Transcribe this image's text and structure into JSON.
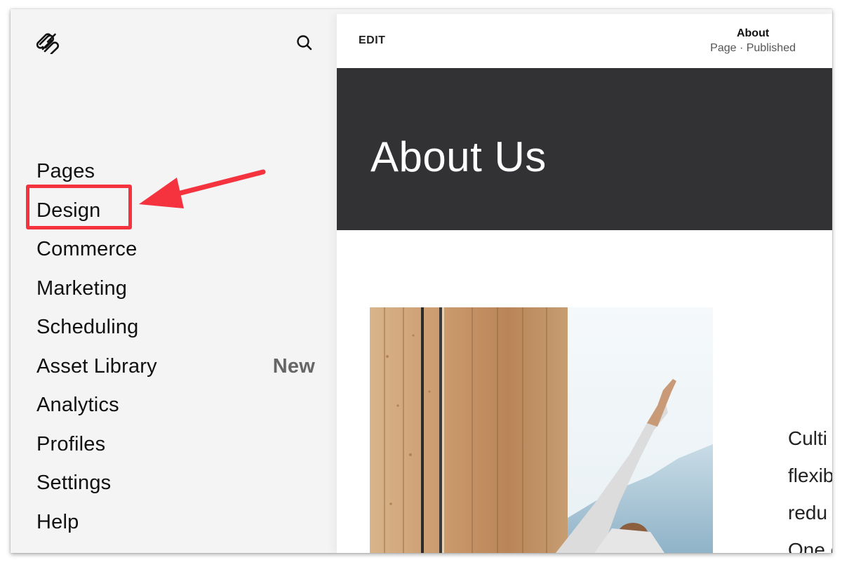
{
  "sidebar": {
    "logo_icon": "squarespace-logo-icon",
    "search_icon": "search-icon",
    "items": [
      {
        "label": "Pages"
      },
      {
        "label": "Design",
        "highlighted": true
      },
      {
        "label": "Commerce"
      },
      {
        "label": "Marketing"
      },
      {
        "label": "Scheduling"
      },
      {
        "label": "Asset Library",
        "badge": "New"
      },
      {
        "label": "Analytics"
      },
      {
        "label": "Profiles"
      },
      {
        "label": "Settings"
      },
      {
        "label": "Help"
      }
    ]
  },
  "preview": {
    "edit_label": "EDIT",
    "page_name": "About",
    "page_status": "Page · Published",
    "banner_title": "About Us",
    "body_lines": [
      "Culti",
      "flexib",
      "redu",
      "One c"
    ]
  },
  "annotation": {
    "target": "Design",
    "color": "#f4333f"
  },
  "colors": {
    "sidebar_bg": "#f4f4f4",
    "banner_bg": "#323234",
    "text": "#111111",
    "badge_text": "#666666"
  }
}
